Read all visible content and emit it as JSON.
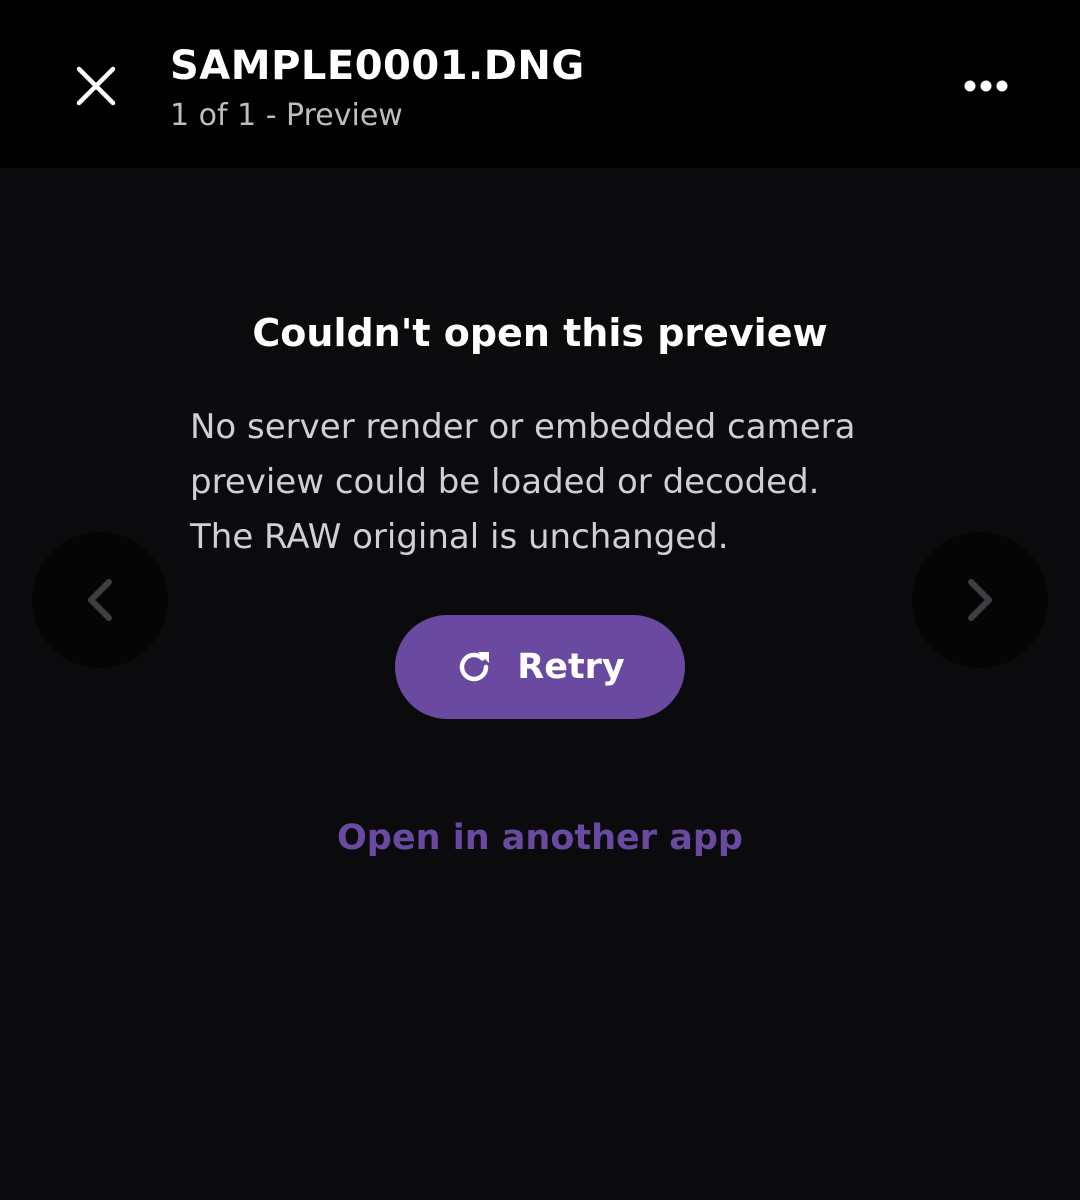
{
  "header": {
    "file_name": "SAMPLE0001.DNG",
    "subtitle": "1 of 1 - Preview",
    "close_icon": "close-icon",
    "more_icon": "more-horizontal-icon"
  },
  "error": {
    "title": "Couldn't open this preview",
    "message_lines": [
      "No server render or embedded camera",
      "preview could be loaded or decoded.",
      "The RAW original is unchanged."
    ]
  },
  "actions": {
    "retry_label": "Retry",
    "retry_icon": "refresh-icon",
    "open_other_label": "Open in another app"
  },
  "navigation": {
    "prev_icon": "chevron-left-icon",
    "next_icon": "chevron-right-icon"
  },
  "colors": {
    "accent": "#6a4aa0",
    "background": "#0b0b0e",
    "topbar": "#000000"
  }
}
